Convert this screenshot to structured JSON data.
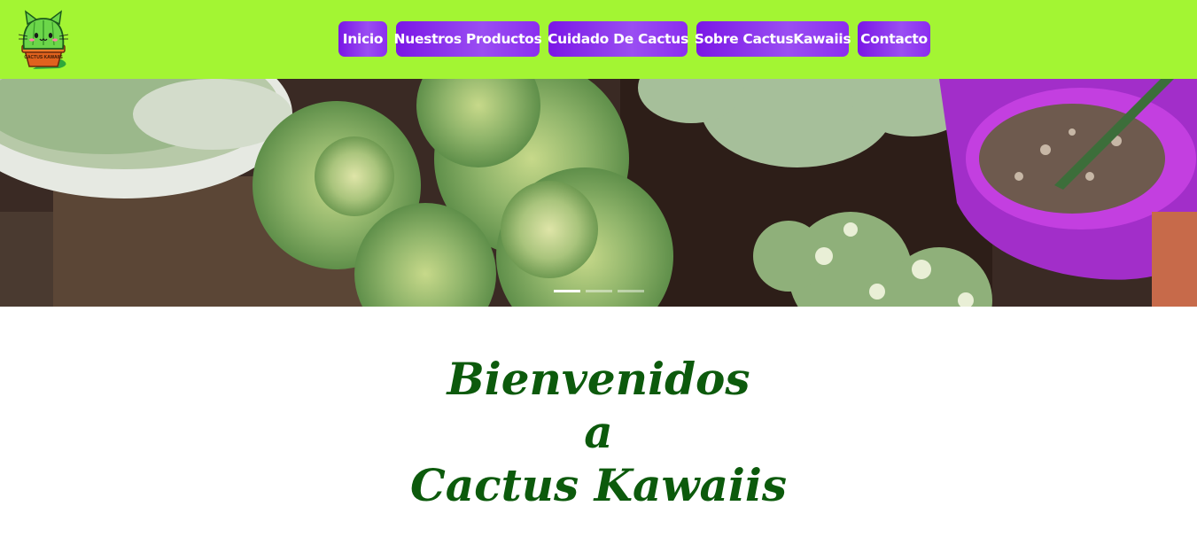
{
  "brand": {
    "logo_icon": "kawaii-cactus-cat-logo-icon",
    "logo_text": "CACTUS KAWAIIS",
    "colors": {
      "navbar": "#a3f533",
      "button": "#8b2df0",
      "heading": "#0c5a0c"
    }
  },
  "nav": {
    "items": [
      {
        "label": "Inicio"
      },
      {
        "label": "Nuestros Productos"
      },
      {
        "label": "Cuidado De Cactus"
      },
      {
        "label": "Sobre CactusKawaiis"
      },
      {
        "label": "Contacto"
      }
    ]
  },
  "carousel": {
    "image": "succulents-in-pots-photo",
    "slide_count": 3,
    "active_slide": 1
  },
  "welcome": {
    "line1": "Bienvenidos",
    "line2": "a",
    "line3": "Cactus Kawaiis"
  }
}
